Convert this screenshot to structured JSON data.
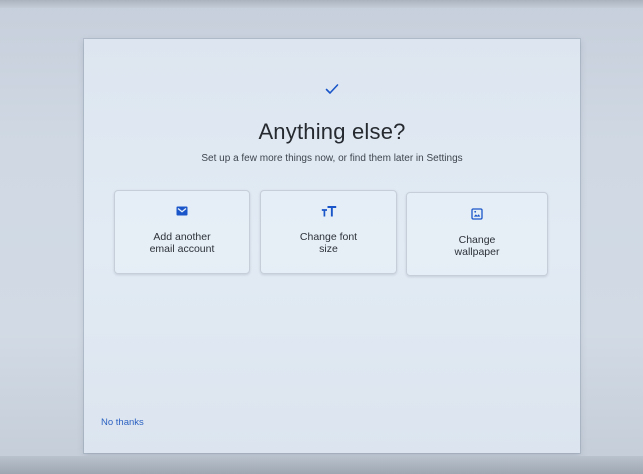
{
  "header": {
    "check_icon": "checkmark-icon",
    "title": "Anything else?",
    "subtitle": "Set up a few more things now, or find them later in Settings"
  },
  "options": [
    {
      "icon": "mail-icon",
      "line1": "Add another",
      "line2": "email account"
    },
    {
      "icon": "font-size-icon",
      "line1": "Change font",
      "line2": "size"
    },
    {
      "icon": "wallpaper-icon",
      "line1": "Change",
      "line2": "wallpaper"
    }
  ],
  "footer": {
    "no_thanks": "No thanks"
  },
  "colors": {
    "accent": "#1a56c9",
    "link": "#2e62c2",
    "title": "#262a30"
  }
}
